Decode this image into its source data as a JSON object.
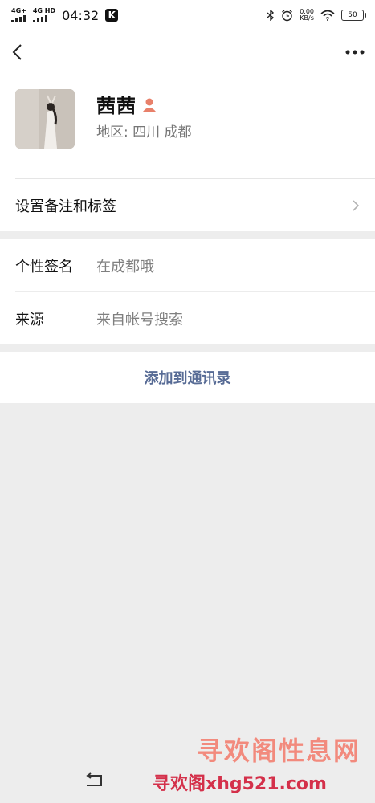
{
  "status_bar": {
    "net1": "4G+",
    "net2": "4G HD",
    "time": "04:32",
    "app_badge": "K",
    "speed_value": "0.00",
    "speed_unit": "KB/s",
    "battery": "50"
  },
  "profile": {
    "name": "茜茜",
    "region": "地区:  四川  成都",
    "remark_label": "设置备注和标签"
  },
  "info": {
    "signature_label": "个性签名",
    "signature_value": "在成都哦",
    "source_label": "来源",
    "source_value": "来自帐号搜索"
  },
  "actions": {
    "add_label": "添加到通讯录"
  },
  "watermark": {
    "title": "寻欢阁性息网",
    "url": "寻欢阁xhg521.com"
  },
  "colors": {
    "link": "#576b95",
    "gender_icon": "#e8806a",
    "background": "#ededed"
  }
}
